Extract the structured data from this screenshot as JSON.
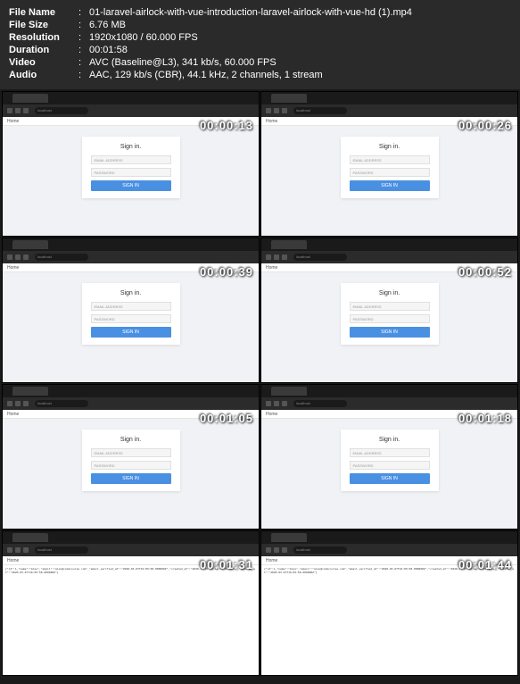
{
  "info": {
    "filename_label": "File Name",
    "filename_value": "01-laravel-airlock-with-vue-introduction-laravel-airlock-with-vue-hd (1).mp4",
    "filesize_label": "File Size",
    "filesize_value": "6.76 MB",
    "resolution_label": "Resolution",
    "resolution_value": "1920x1080 / 60.000 FPS",
    "duration_label": "Duration",
    "duration_value": "00:01:58",
    "video_label": "Video",
    "video_value": "AVC (Baseline@L3), 341 kb/s, 60.000 FPS",
    "audio_label": "Audio",
    "audio_value": "AAC, 129 kb/s (CBR), 44.1 kHz, 2 channels, 1 stream"
  },
  "separator": ":",
  "nav_home": "Home",
  "url_text": "localhost",
  "signin": {
    "title": "Sign in.",
    "email_ph": "EMAIL ADDRESS",
    "password_ph": "PASSWORD",
    "button": "SIGN IN"
  },
  "json_output": "{\"id\":1,\"name\":\"Alex\",\"email\":\"alex@codecourse.com\",\"email_verified_at\":\"2020-03-07T16:05:58.000000Z\",\"created_at\":\"2020-03-07T16:05:58.000000Z\",\"updated_at\":\"2020-03-07T16:05:58.000000Z\"}",
  "timestamps": [
    "00:00:13",
    "00:00:26",
    "00:00:39",
    "00:00:52",
    "00:01:05",
    "00:01:18",
    "00:01:31",
    "00:01:44"
  ]
}
